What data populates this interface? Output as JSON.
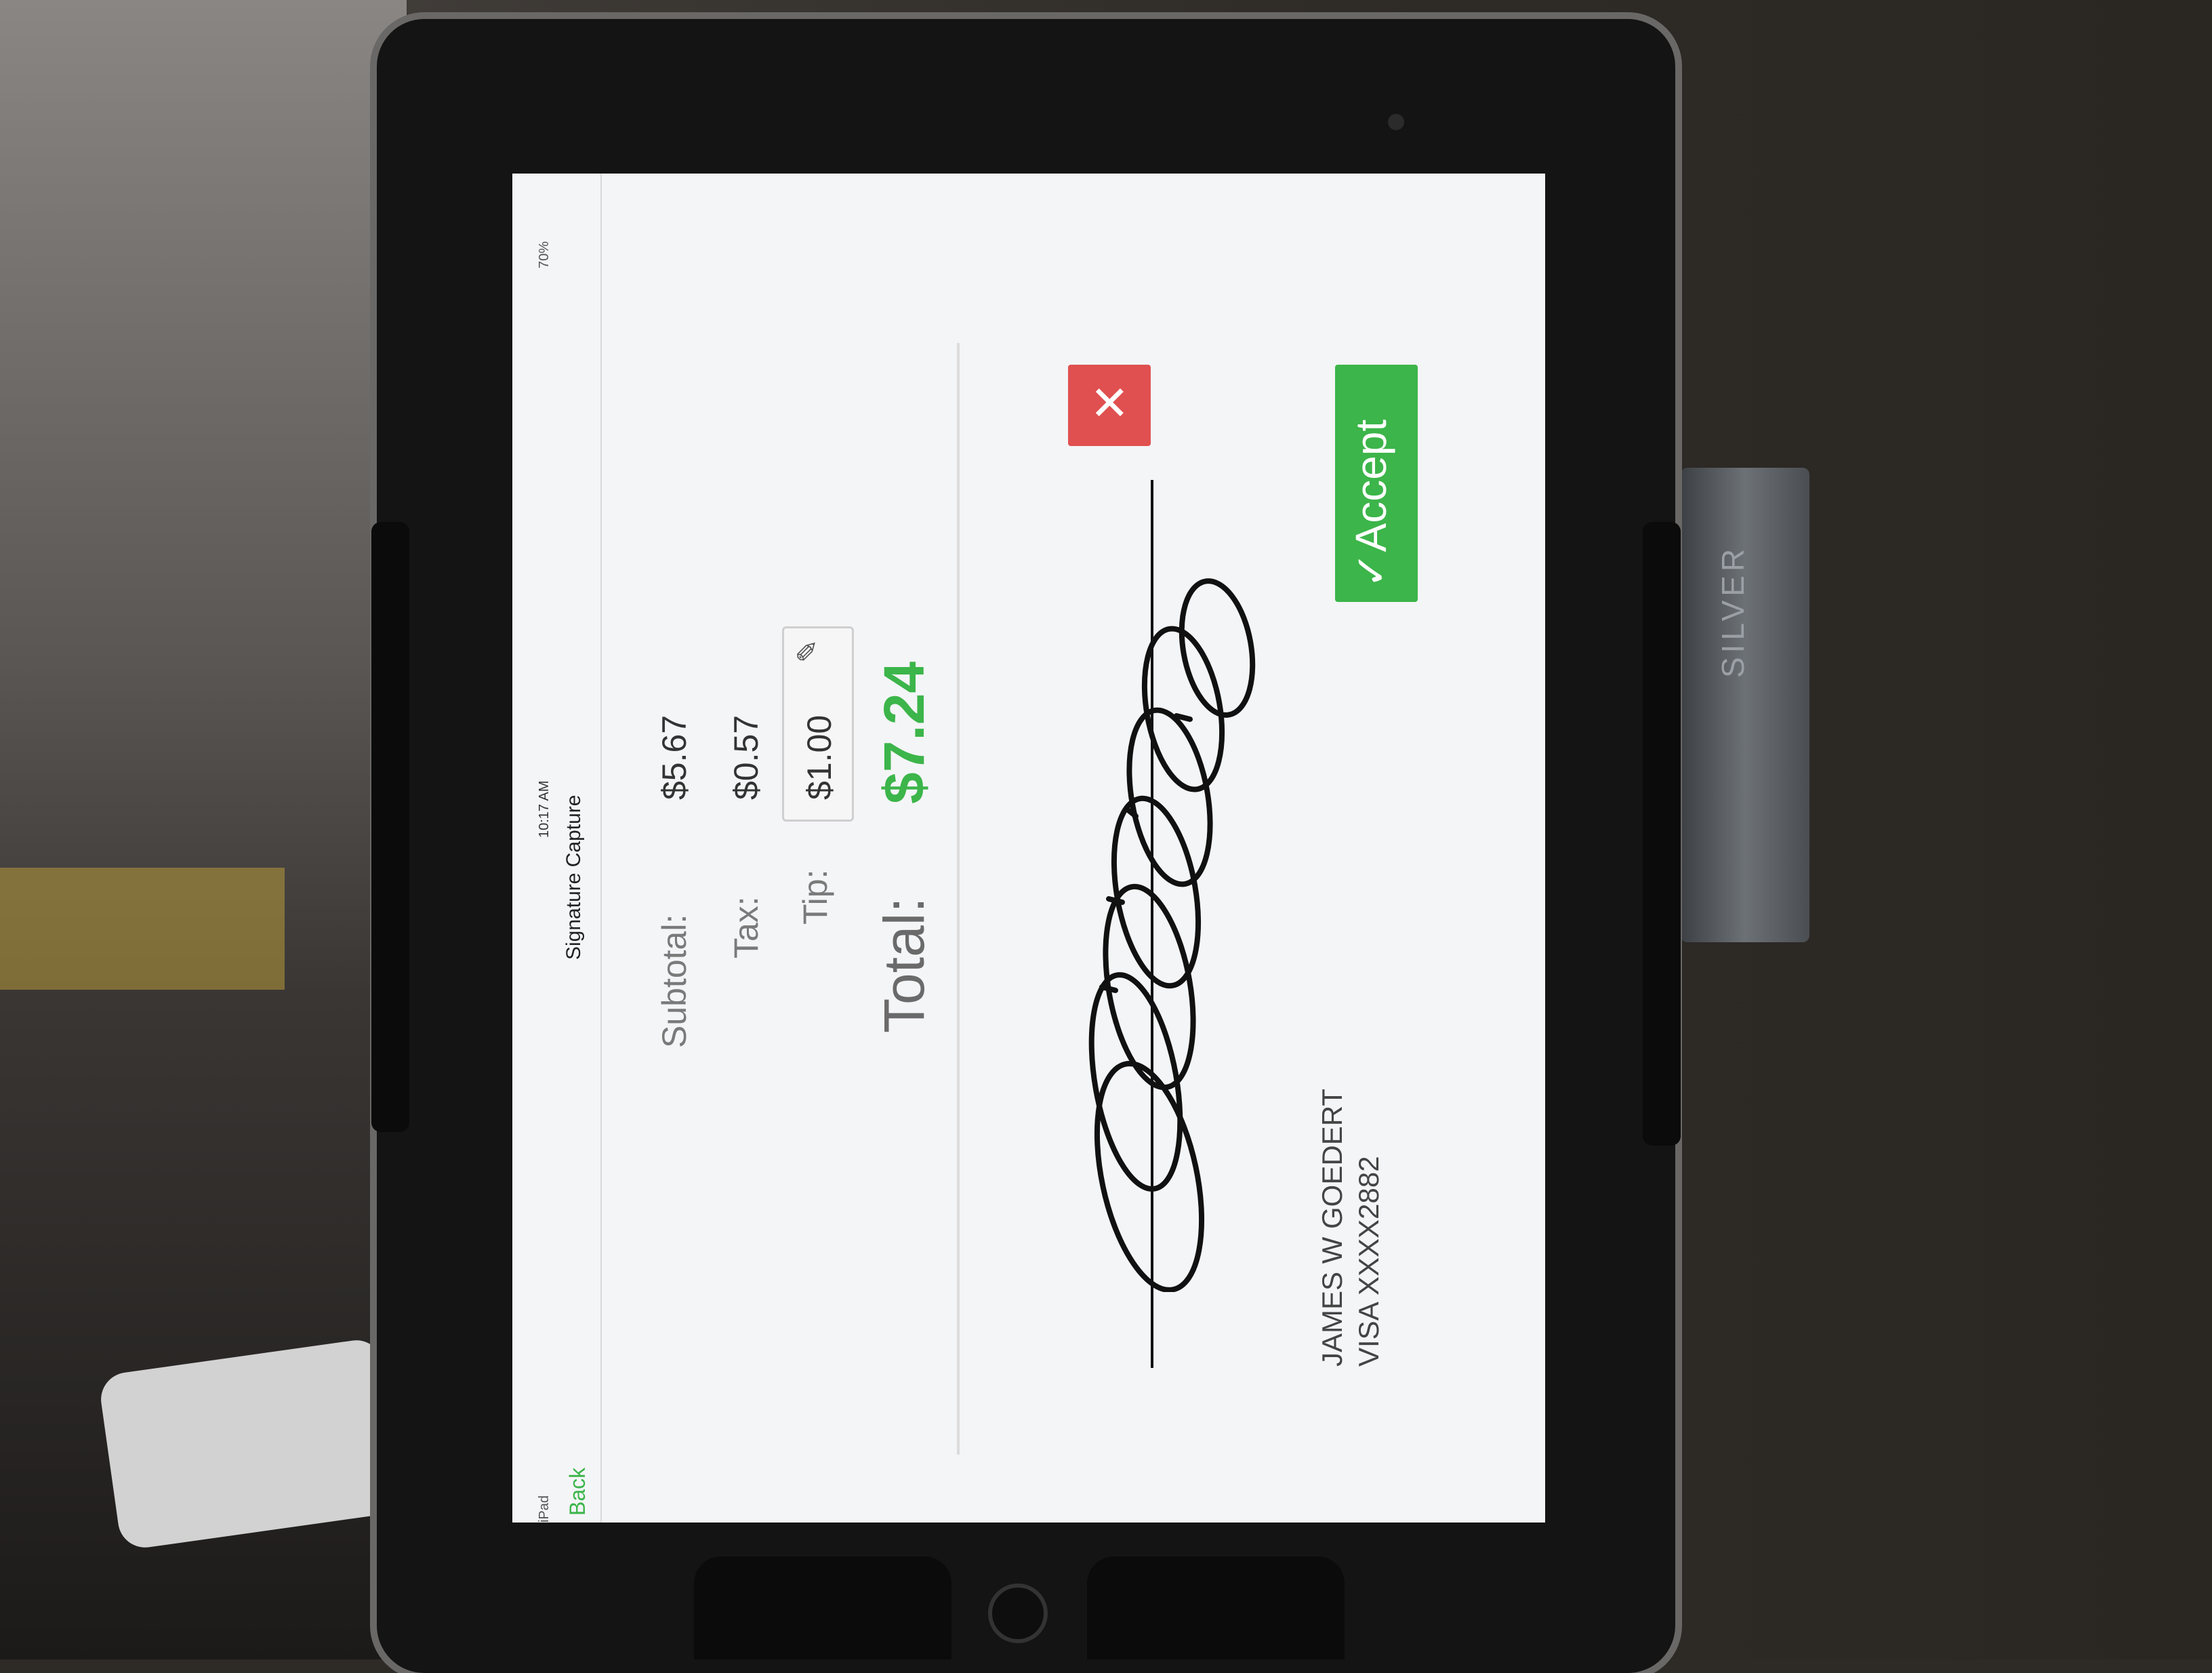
{
  "status_bar": {
    "device": "iPad",
    "time": "10:17 AM",
    "battery": "70%"
  },
  "header": {
    "title": "Signature Capture",
    "back_label": "Back"
  },
  "summary": {
    "subtotal_label": "Subtotal:",
    "subtotal_value": "$5.67",
    "tax_label": "Tax:",
    "tax_value": "$0.57",
    "tip_label": "Tip:",
    "tip_value": "$1.00",
    "total_label": "Total:",
    "total_value": "$7.24"
  },
  "actions": {
    "cancel_symbol": "✕",
    "accept_label": "✓Accept"
  },
  "card": {
    "name": "JAMES W GOEDERT",
    "number": "VISA XXXX2882"
  },
  "card_reader": {
    "brand": "SILVER"
  },
  "colors": {
    "accent_green": "#3cb54a",
    "cancel_red": "#e05050"
  },
  "icons": {
    "tip_edit": "pencil-icon"
  }
}
